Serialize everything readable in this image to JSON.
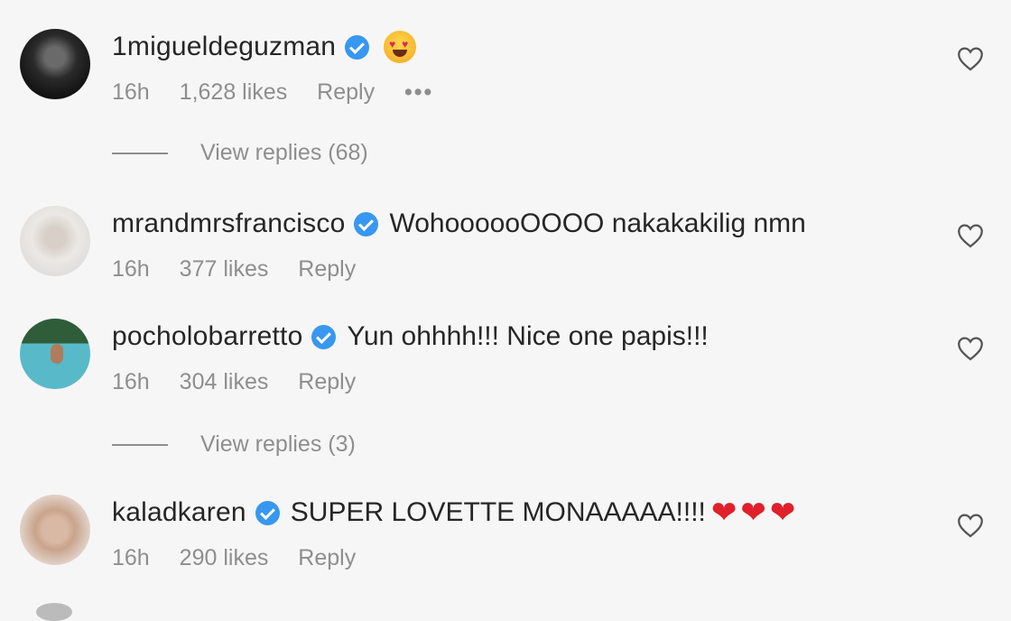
{
  "comments": [
    {
      "username": "1migueldeguzman",
      "text": "",
      "emoji": "heart-eyes",
      "time": "16h",
      "likes": "1,628 likes",
      "reply": "Reply",
      "more": "•••"
    },
    {
      "username": "mrandmrsfrancisco",
      "text": "WohoooooOOOO nakakakilig nmn",
      "time": "16h",
      "likes": "377 likes",
      "reply": "Reply"
    },
    {
      "username": "pocholobarretto",
      "text": "Yun ohhhh!!! Nice one papis!!!",
      "time": "16h",
      "likes": "304 likes",
      "reply": "Reply"
    },
    {
      "username": "kaladkaren",
      "text": "SUPER LOVETTE MONAAAAA!!!!",
      "emoji": "❤❤❤",
      "time": "16h",
      "likes": "290 likes",
      "reply": "Reply"
    }
  ],
  "view_replies": [
    {
      "label": "View replies (68)"
    },
    {
      "label": "View replies (3)"
    }
  ],
  "colors": {
    "verified": "#3897f0",
    "meta_text": "#8e8e8e",
    "background": "#f6f6f6"
  }
}
